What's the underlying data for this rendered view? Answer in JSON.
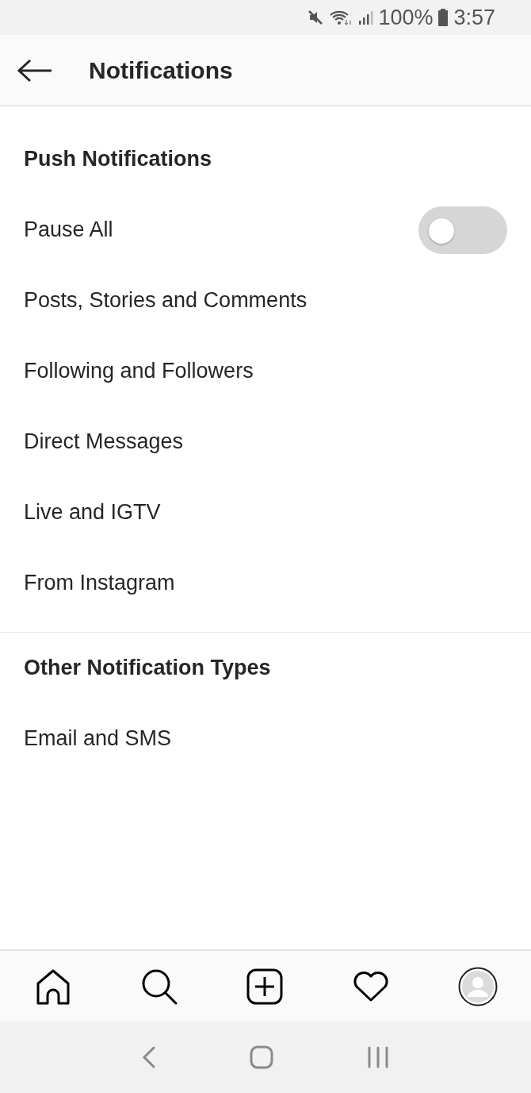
{
  "status_bar": {
    "battery": "100%",
    "time": "3:57"
  },
  "header": {
    "title": "Notifications"
  },
  "sections": [
    {
      "title": "Push Notifications",
      "items": [
        {
          "kind": "toggle",
          "label": "Pause All",
          "on": false
        },
        {
          "kind": "link",
          "label": "Posts, Stories and Comments"
        },
        {
          "kind": "link",
          "label": "Following and Followers"
        },
        {
          "kind": "link",
          "label": "Direct Messages"
        },
        {
          "kind": "link",
          "label": "Live and IGTV"
        },
        {
          "kind": "link",
          "label": "From Instagram"
        }
      ]
    },
    {
      "title": "Other Notification Types",
      "items": [
        {
          "kind": "link",
          "label": "Email and SMS"
        }
      ]
    }
  ],
  "tab_bar": [
    {
      "kind": "home"
    },
    {
      "kind": "search"
    },
    {
      "kind": "add"
    },
    {
      "kind": "heart"
    },
    {
      "kind": "profile"
    }
  ]
}
